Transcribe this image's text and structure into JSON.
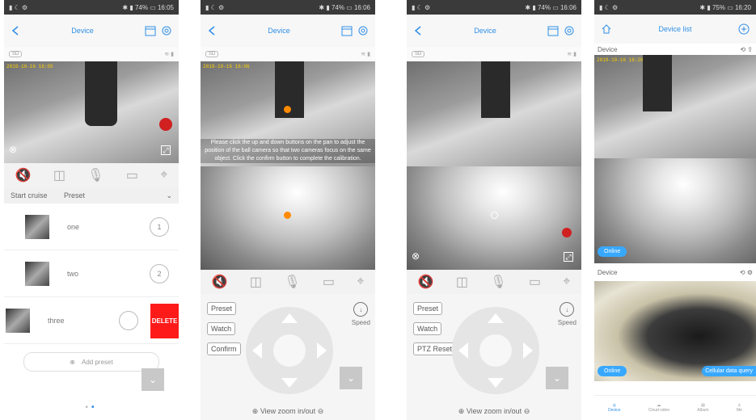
{
  "colors": {
    "accent": "#2f8fe6",
    "delete": "#ff1a1a",
    "online": "#38a8ff",
    "marker": "#ff8a00"
  },
  "panel1": {
    "status_left": "▮ ☾ ⚙",
    "status_right": "✱ ▮ 74% ▭ 16:05",
    "nav_title": "Device",
    "tag": "SD",
    "timestamp": "2019-10-16 16:05",
    "tabs": {
      "left": "Start cruise",
      "mid": "Preset"
    },
    "presets": [
      {
        "label": "one",
        "num": "1"
      },
      {
        "label": "two",
        "num": "2"
      },
      {
        "label": "three",
        "num": ""
      }
    ],
    "delete_label": "DELETE",
    "add_preset": "Add preset"
  },
  "panel2": {
    "status_left": "▮ ☾ ⚙",
    "status_right": "✱ ▮ 74% ▭ 16:06",
    "nav_title": "Device",
    "tag": "SD",
    "timestamp": "2019-10-16 16:06",
    "instruction": "Please click the up and down buttons on the pan to adjust the position of the ball camera so that two cameras focus on the same object. Click the confirm button to complete the calibration.",
    "buttons": {
      "preset": "Preset",
      "watch": "Watch",
      "confirm": "Confirm"
    },
    "speed": "Speed",
    "zoom": "View zoom in/out"
  },
  "panel3": {
    "status_left": "▮ ☾ ⚙",
    "status_right": "✱ ▮ 74% ▭ 16:06",
    "nav_title": "Device",
    "tag": "SD",
    "buttons": {
      "preset": "Preset",
      "watch": "Watch",
      "reset": "PTZ Reset"
    },
    "speed": "Speed",
    "zoom": "View zoom in/out"
  },
  "panel4": {
    "status_left": "▮ ☾ ⚙",
    "status_right": "✱ ▮ 75% ▭ 16:20",
    "nav_title": "Device list",
    "device1": "Device",
    "device2": "Device",
    "timestamp": "2019-10-16 16:20",
    "online": "Online",
    "cellular": "Cellular data query",
    "nav": [
      "Device",
      "Cloud video",
      "Album",
      "Me"
    ]
  }
}
